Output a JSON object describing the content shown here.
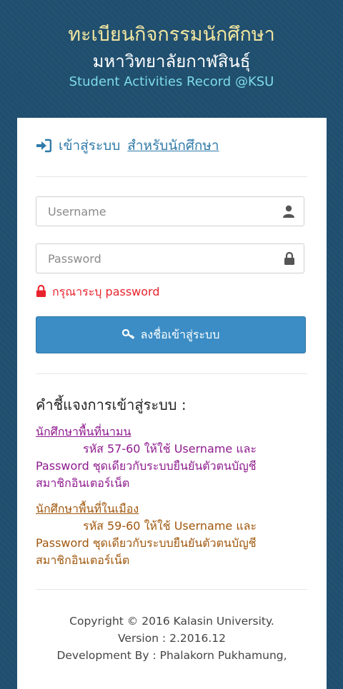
{
  "header": {
    "title_th": "ทะเบียนกิจกรรมนักศึกษา",
    "university_th": "มหาวิทยาลัยกาฬสินธุ์",
    "title_en": "Student Activities Record @KSU"
  },
  "login": {
    "heading": "เข้าสู่ระบบ",
    "heading_link": "สำหรับนักศึกษา",
    "username_placeholder": "Username",
    "password_placeholder": "Password",
    "error": "กรุณาระบุ password",
    "submit": "ลงชื่อเข้าสู่ระบบ"
  },
  "instructions": {
    "title": "คำชี้แจงการเข้าสู่ระบบ :",
    "groups": [
      {
        "heading": "นักศึกษาพื้นที่นามน",
        "line1": "รหัส 57-60 ให้ใช้ Username และ",
        "line2": "Password ชุดเดียวกับระบบยืนยันตัวตนบัญชี",
        "line3": "สมาชิกอินเตอร์เน็ต"
      },
      {
        "heading": "นักศึกษาพื้นที่ในเมือง",
        "line1": "รหัส 59-60 ให้ใช้ Username และ",
        "line2": "Password ชุดเดียวกับระบบยืนยันตัวตนบัญชี",
        "line3": "สมาชิกอินเตอร์เน็ต"
      }
    ]
  },
  "footer": {
    "copyright": "Copyright © 2016 Kalasin University.",
    "version": "Version : 2.2016.12",
    "developer": "Development By : Phalakorn Pukhamung,"
  },
  "colors": {
    "background": "#1f4e6e",
    "title_gold": "#f2e6a0",
    "title_cyan": "#7fdbe8",
    "primary": "#3c8dc5",
    "error": "#e8232d",
    "purple": "#8e1a8e",
    "brown": "#a0570d"
  },
  "icons": [
    "sign-in-icon",
    "user-icon",
    "lock-icon",
    "key-icon"
  ]
}
